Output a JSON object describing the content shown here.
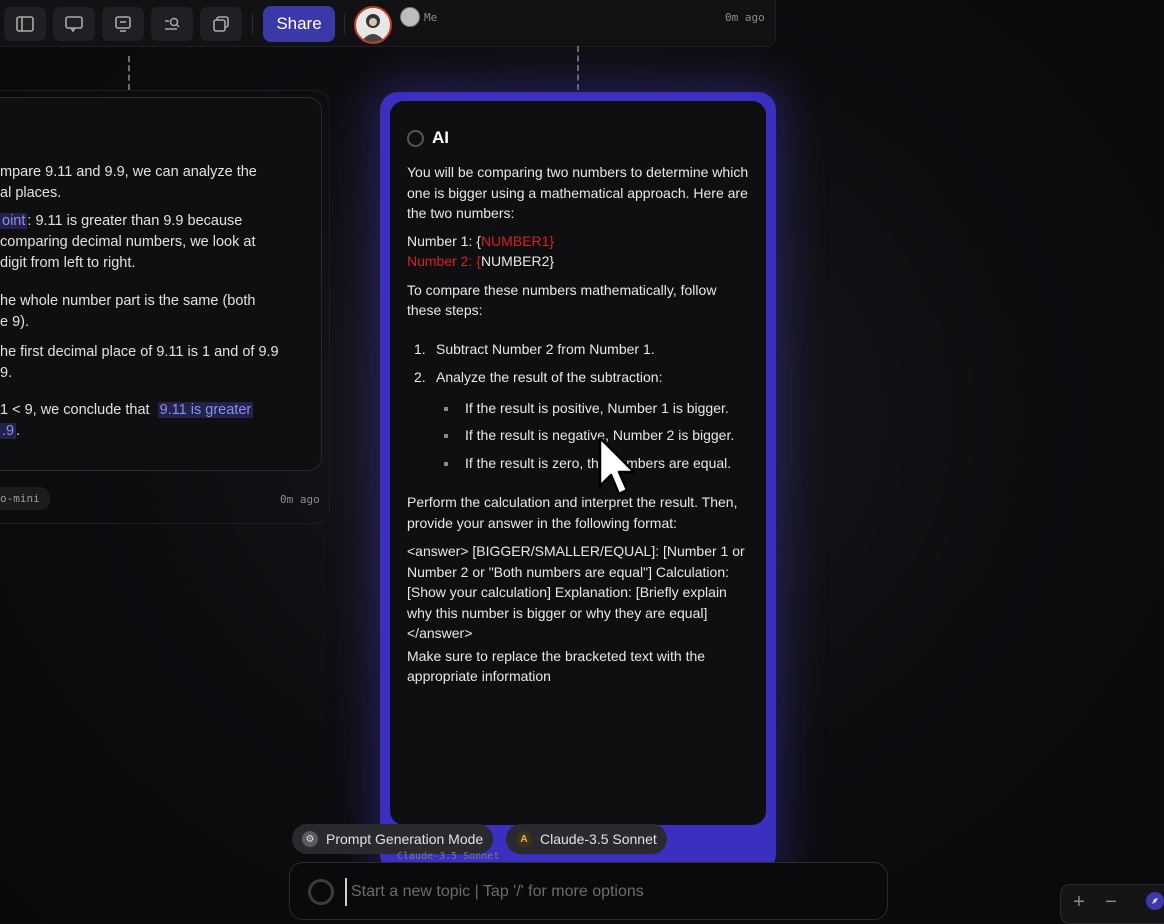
{
  "toolbar": {
    "share_label": "Share",
    "user_label": "Me",
    "timestamp": "0m ago",
    "icons": [
      "sidebar-icon",
      "comment-icon",
      "present-icon",
      "search-list-icon",
      "copy-icon"
    ]
  },
  "left_card": {
    "lines": [
      "mpare 9.11 and 9.9, we can analyze the",
      "al places.",
      ": 9.11 is greater than 9.9 because",
      "comparing decimal numbers, we look at",
      "digit from left to right.",
      "he whole number part is the same (both",
      "e 9).",
      "he first decimal place of 9.11 is 1 and of 9.9",
      "9.",
      "1 < 9, we conclude that",
      "."
    ],
    "highlight_point": "oint",
    "highlight_conclusion_1": "9.11 is greater",
    "highlight_conclusion_2": ".9",
    "model_label": "o-mini",
    "timestamp": "0m ago"
  },
  "ai_card": {
    "title": "AI",
    "intro": "You will be comparing two numbers to determine which one is bigger using a mathematical approach. Here are the two numbers:",
    "number1_label": "Number 1: {",
    "number1_var": "NUMBER1}",
    "number2_label": "Number 2: {",
    "number2_var": "NUMBER2}",
    "steps_intro": "To compare these numbers mathematically, follow these steps:",
    "steps": [
      {
        "num": "1.",
        "text": "Subtract Number 2 from Number 1."
      },
      {
        "num": "2.",
        "text": "Analyze the result of the subtraction:"
      }
    ],
    "bullets": [
      "If the result is positive, Number 1 is bigger.",
      "If the result is negative, Number 2 is bigger.",
      "If the result is zero, the numbers are equal."
    ],
    "perform": "Perform the calculation and interpret the result. Then, provide your answer in the following format:",
    "format": "<answer> [BIGGER/SMALLER/EQUAL]: [Number 1 or Number 2 or \"Both numbers are equal\"] Calculation: [Show your calculation] Explanation: [Briefly explain why this number is bigger or why they are equal] </answer>",
    "closing": "Make sure to replace the bracketed text with the appropriate information"
  },
  "chips": {
    "mode": "Prompt Generation Mode",
    "model": "Claude-3.5 Sonnet",
    "peek_model": "Claude-3.5 Sonnet"
  },
  "input": {
    "placeholder": "Start a new topic | Tap '/' for more options"
  },
  "zoom": {
    "plus": "+",
    "minus": "−"
  },
  "colors": {
    "accent": "#3b39a8",
    "card_border": "#3b2fc0",
    "variable_red": "#d52222",
    "highlight": "#8d8df0"
  }
}
